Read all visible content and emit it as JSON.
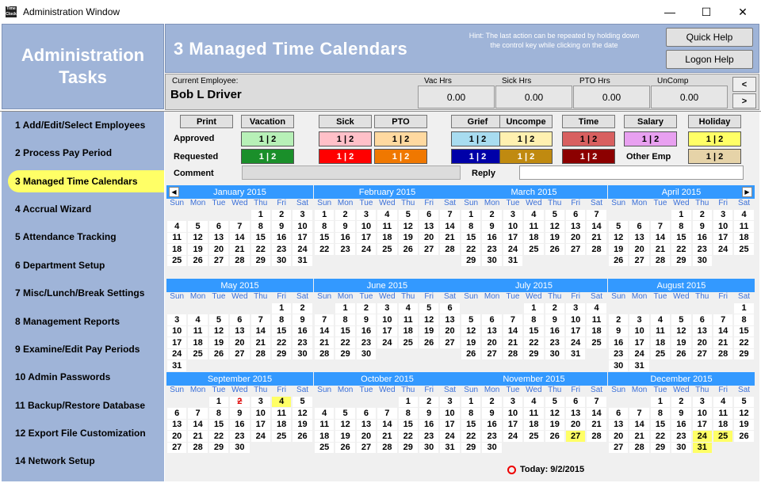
{
  "window": {
    "title": "Administration Window",
    "icon_text": "Time Clock",
    "minimize": "—",
    "maximize": "☐",
    "close": "✕"
  },
  "sidebar": {
    "title_line1": "Administration",
    "title_line2": "Tasks",
    "items": [
      {
        "label": "1 Add/Edit/Select Employees"
      },
      {
        "label": "2 Process Pay Period"
      },
      {
        "label": "3 Managed Time Calendars",
        "active": true
      },
      {
        "label": "4 Accrual Wizard"
      },
      {
        "label": "5 Attendance Tracking"
      },
      {
        "label": "6 Department Setup"
      },
      {
        "label": "7 Misc/Lunch/Break Settings"
      },
      {
        "label": "8 Management Reports"
      },
      {
        "label": "9 Examine/Edit Pay Periods"
      },
      {
        "label": "10 Admin Passwords"
      },
      {
        "label": "11 Backup/Restore Database"
      },
      {
        "label": "12 Export File Customization"
      },
      {
        "label": "14 Network Setup"
      }
    ]
  },
  "header": {
    "title": "3  Managed Time Calendars",
    "hint": "Hint: The last action can be repeated by holding down the control key while clicking on the date",
    "quick_help": "Quick Help",
    "logon_help": "Logon Help"
  },
  "employee": {
    "current_label": "Current Employee:",
    "name": "Bob L Driver",
    "hours": [
      {
        "label": "Vac Hrs",
        "value": "0.00"
      },
      {
        "label": "Sick Hrs",
        "value": "0.00"
      },
      {
        "label": "PTO Hrs",
        "value": "0.00"
      },
      {
        "label": "UnComp",
        "value": "0.00"
      }
    ],
    "prev": "<",
    "next": ">"
  },
  "legend": {
    "print": "Print",
    "approved_label": "Approved",
    "requested_label": "Requested",
    "comment_label": "Comment",
    "reply_label": "Reply",
    "other_emp_label": "Other Emp",
    "swatch_text": "1 | 2",
    "types": [
      {
        "name": "Vacation",
        "approved": "#b7f0b7",
        "requested": "#1a8f2a",
        "req_text": "#ffffff"
      },
      {
        "name": "Sick",
        "approved": "#ffc0c8",
        "requested": "#ff0000",
        "req_text": "#ffffff"
      },
      {
        "name": "PTO",
        "approved": "#ffd9a0",
        "requested": "#f07800",
        "req_text": "#ffffff"
      },
      {
        "name": "Grief",
        "approved": "#a8dcf0",
        "requested": "#0000a8",
        "req_text": "#ffffff"
      },
      {
        "name": "Uncompe",
        "approved": "#fff0b0",
        "requested": "#c08a10",
        "req_text": "#ffffff"
      },
      {
        "name": "Time",
        "approved": "#d86060",
        "requested": "#8c0000",
        "req_text": "#ffffff"
      },
      {
        "name": "Salary",
        "approved": "#e8a0f0",
        "requested": "",
        "req_text": ""
      },
      {
        "name": "Holiday",
        "approved": "#ffff66",
        "requested": "#e6d3a8",
        "req_text": "#000000"
      }
    ]
  },
  "calendar": {
    "prev_arrow": "◀",
    "next_arrow": "▶",
    "dow": [
      "Sun",
      "Mon",
      "Tue",
      "Wed",
      "Thu",
      "Fri",
      "Sat"
    ],
    "today_label": "Today: 9/2/2015",
    "months": [
      {
        "name": "January  2015",
        "offset": 4,
        "days": 31,
        "holidays": []
      },
      {
        "name": "February  2015",
        "offset": 0,
        "days": 28,
        "holidays": []
      },
      {
        "name": "March  2015",
        "offset": 0,
        "days": 31,
        "holidays": []
      },
      {
        "name": "April  2015",
        "offset": 3,
        "days": 30,
        "holidays": []
      },
      {
        "name": "May  2015",
        "offset": 5,
        "days": 31,
        "holidays": []
      },
      {
        "name": "June  2015",
        "offset": 1,
        "days": 30,
        "holidays": []
      },
      {
        "name": "July  2015",
        "offset": 3,
        "days": 31,
        "holidays": []
      },
      {
        "name": "August  2015",
        "offset": 6,
        "days": 31,
        "holidays": []
      },
      {
        "name": "September  2015",
        "offset": 2,
        "days": 30,
        "holidays": [
          4
        ],
        "today": 2
      },
      {
        "name": "October  2015",
        "offset": 4,
        "days": 31,
        "holidays": []
      },
      {
        "name": "November  2015",
        "offset": 0,
        "days": 30,
        "holidays": [
          27
        ]
      },
      {
        "name": "December  2015",
        "offset": 2,
        "days": 31,
        "holidays": [
          24,
          25,
          31
        ]
      }
    ]
  }
}
